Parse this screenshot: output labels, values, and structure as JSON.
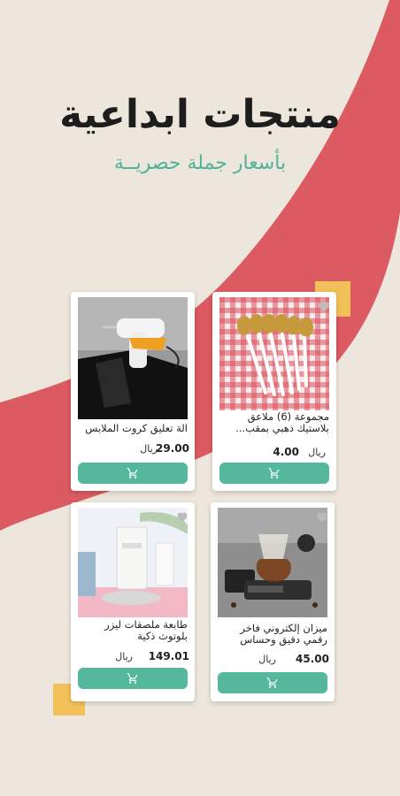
{
  "header": {
    "title": "منتجات ابداعية",
    "subtitle": "بأسعار جملة حصريــة"
  },
  "colors": {
    "background": "#ece6dc",
    "band": "#dc5a61",
    "accent": "#f3c15a",
    "cart_button": "#55b89d"
  },
  "products": [
    {
      "name": "مجموعة (6) ملاعق بلاستيك ذهبي بمقب...",
      "price": "4.00",
      "currency": "ريال",
      "cart_icon": "cart-icon",
      "heart_icon": "heart-icon"
    },
    {
      "name": "الة تعليق كروت الملابس",
      "price": "29.00",
      "currency": "ريال",
      "cart_icon": "cart-icon"
    },
    {
      "name": "ميزان إلكتروني فاخر رقمي دقيق وحساس",
      "price": "45.00",
      "currency": "ريال",
      "cart_icon": "cart-icon",
      "heart_icon": "heart-icon"
    },
    {
      "name": "طابعة ملصقات ليزر بلوتوث ذكية",
      "price": "149.01",
      "currency": "ريال",
      "cart_icon": "cart-icon",
      "heart_icon": "heart-icon"
    }
  ]
}
